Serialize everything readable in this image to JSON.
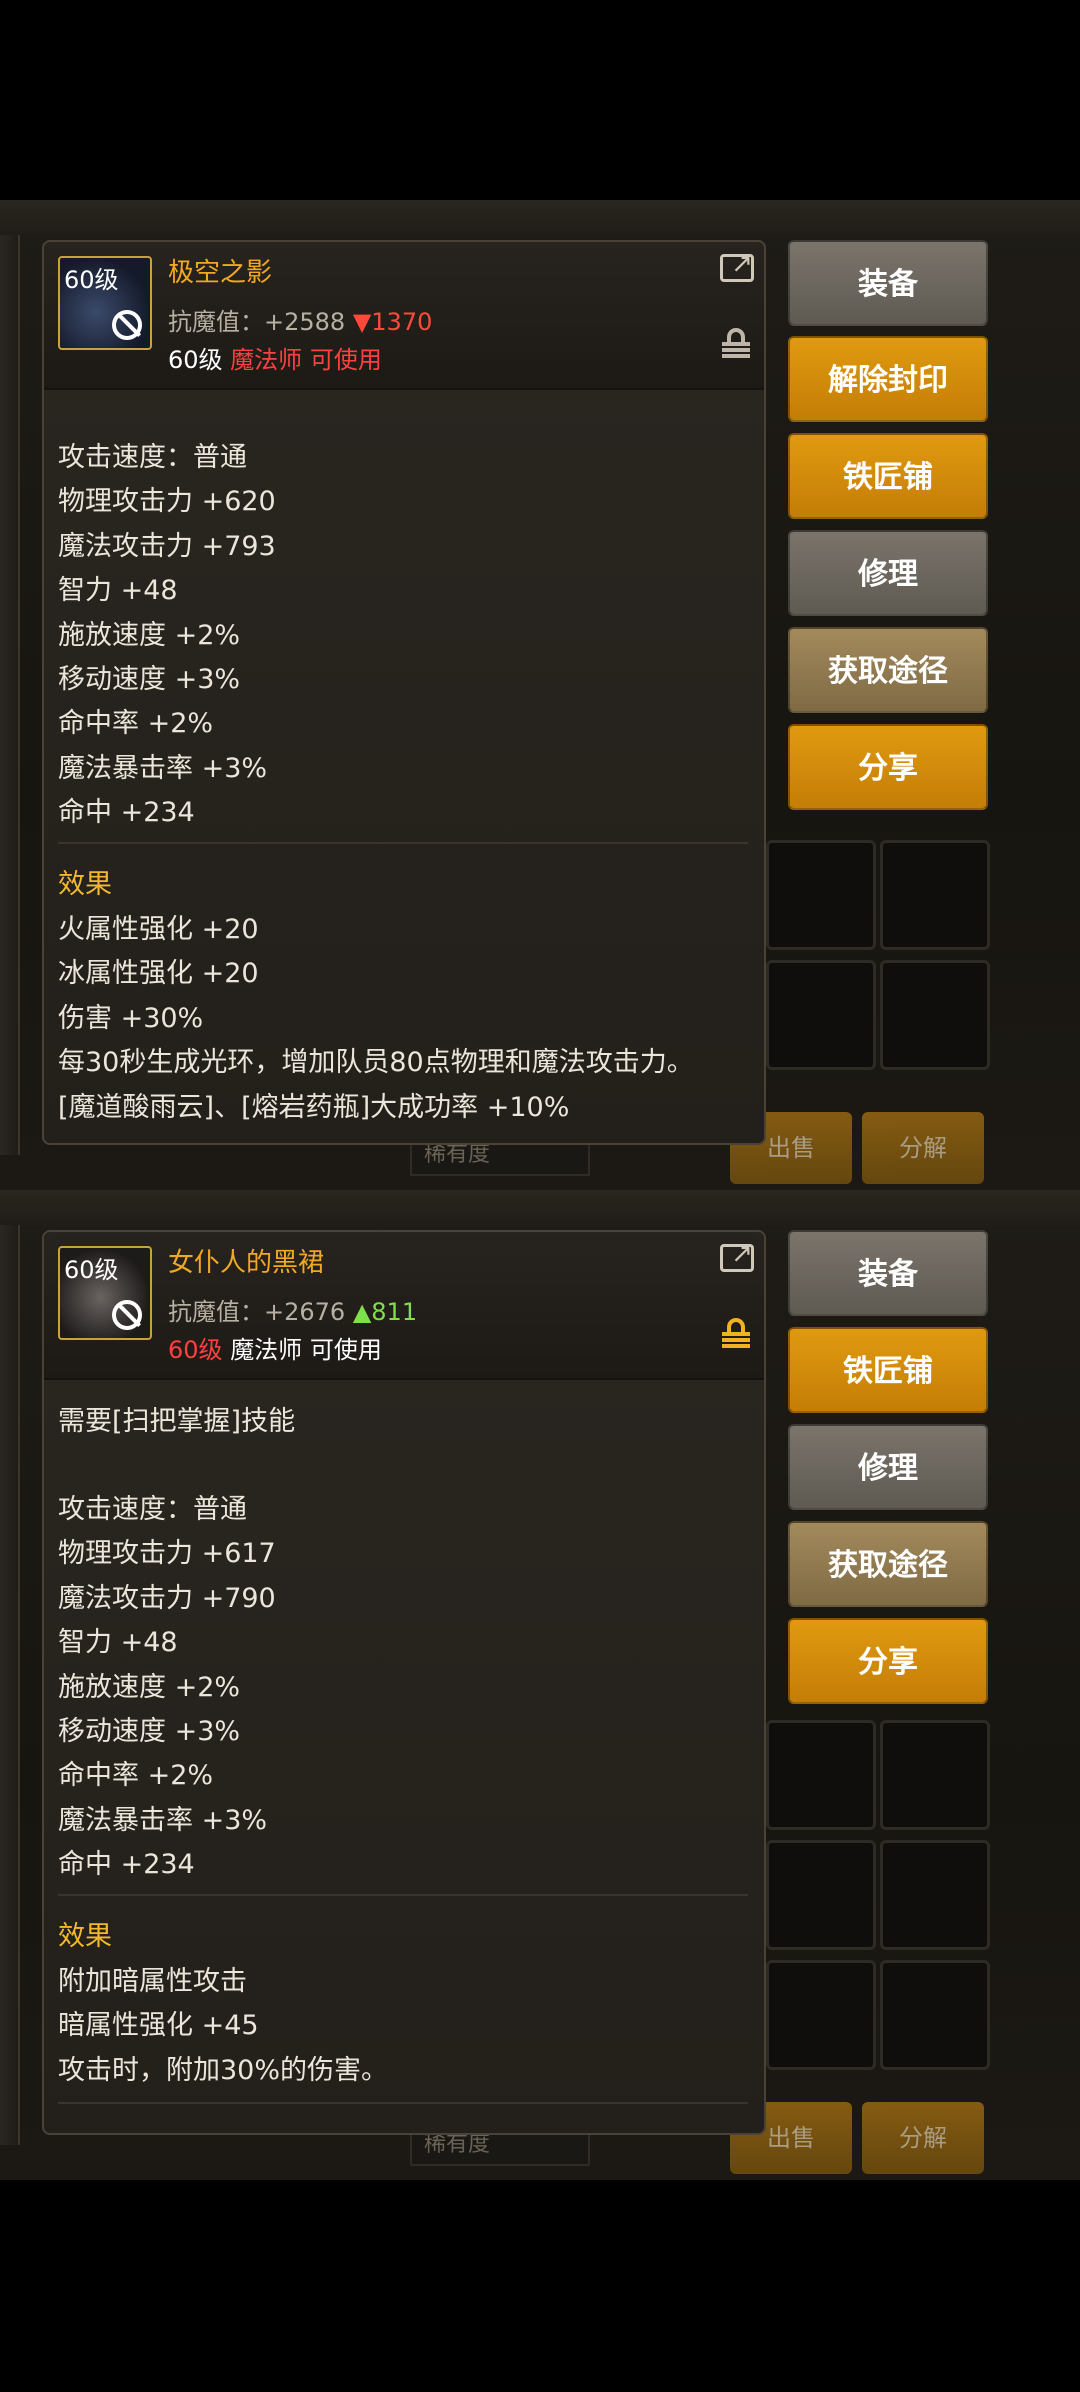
{
  "screens": [
    {
      "item": {
        "level_badge": "60级",
        "name": "极空之影",
        "resist_label": "抗魔值：+2588",
        "resist_delta": "▼1370",
        "req_level": "60级",
        "req_class": "魔法师",
        "req_usable": "可使用"
      },
      "stats": [
        "攻击速度：普通",
        "物理攻击力 +620",
        "魔法攻击力 +793",
        "智力 +48",
        "施放速度 +2%",
        "移动速度 +3%",
        "命中率 +2%",
        "魔法暴击率 +3%",
        "命中 +234"
      ],
      "effects_title": "效果",
      "effects": [
        "火属性强化 +20",
        "冰属性强化 +20",
        "伤害 +30%",
        "每30秒生成光环，增加队员80点物理和魔法攻击力。",
        "[魔道酸雨云]、[熔岩药瓶]大成功率 +10%"
      ],
      "buttons": [
        "装备",
        "解除封印",
        "铁匠铺",
        "修理",
        "获取途径",
        "分享"
      ],
      "bg": {
        "filter_label": "稀有度",
        "sell": "出售",
        "decompose": "分解"
      }
    },
    {
      "item": {
        "level_badge": "60级",
        "name": "女仆人的黑裙",
        "resist_label": "抗魔值：+2676",
        "resist_delta": "▲811",
        "req_level": "60级",
        "req_class": "魔法师",
        "req_usable": "可使用"
      },
      "pre_text": "需要[扫把掌握]技能",
      "stats": [
        "攻击速度：普通",
        "物理攻击力 +617",
        "魔法攻击力 +790",
        "智力 +48",
        "施放速度 +2%",
        "移动速度 +3%",
        "命中率 +2%",
        "魔法暴击率 +3%",
        "命中 +234"
      ],
      "effects_title": "效果",
      "effects": [
        "附加暗属性攻击",
        "暗属性强化 +45",
        "攻击时，附加30%的伤害。"
      ],
      "buttons": [
        "装备",
        "铁匠铺",
        "修理",
        "获取途径",
        "分享"
      ],
      "bg": {
        "filter_label": "稀有度",
        "sell": "出售",
        "decompose": "分解"
      }
    }
  ],
  "colors": {
    "item_name": "#f2a922",
    "button_orange": "#e09a10",
    "button_gray": "#6e6860",
    "button_tan": "#957c50",
    "down": "#ff4a3a",
    "up": "#7ee04a"
  }
}
